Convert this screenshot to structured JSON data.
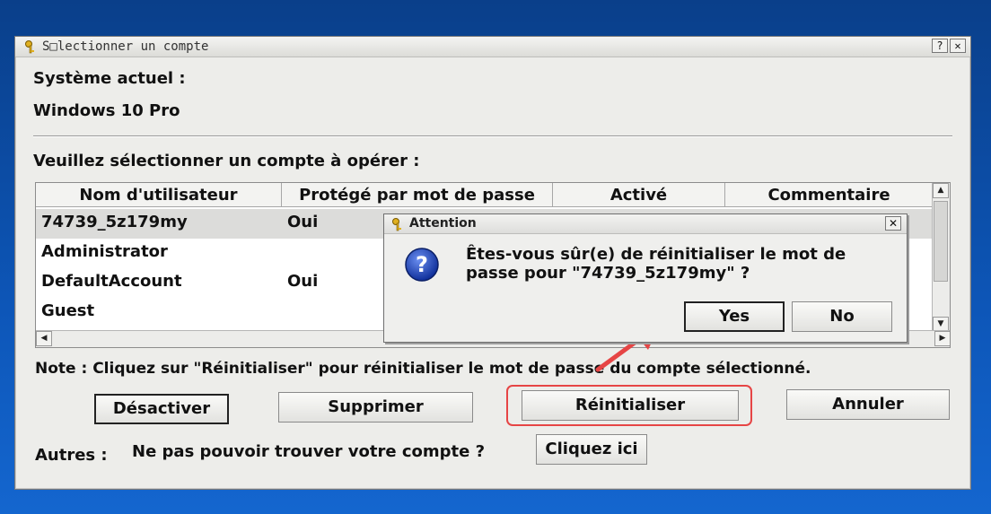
{
  "window": {
    "title": "S□lectionner un compte",
    "help_btn": "?",
    "close_btn": "✕"
  },
  "system": {
    "label": "Système actuel :",
    "value": "Windows 10 Pro"
  },
  "table": {
    "prompt": "Veuillez sélectionner un compte à opérer :",
    "headers": [
      "Nom d'utilisateur",
      "Protégé par mot de passe",
      "Activé",
      "Commentaire"
    ],
    "rows": [
      {
        "user": "74739_5z179my",
        "protected": "Oui"
      },
      {
        "user": "Administrator",
        "protected": ""
      },
      {
        "user": "DefaultAccount",
        "protected": "Oui"
      },
      {
        "user": "Guest",
        "protected": ""
      }
    ]
  },
  "note": "Note : Cliquez sur \"Réinitialiser\" pour réinitialiser le mot de passe du compte sélectionné.",
  "buttons": {
    "deactivate": "Désactiver",
    "delete": "Supprimer",
    "reset": "Réinitialiser",
    "cancel": "Annuler"
  },
  "others": {
    "label": "Autres :",
    "text": "Ne pas pouvoir trouver votre compte ?",
    "link": "Cliquez ici"
  },
  "dialog": {
    "title": "Attention",
    "close_btn": "✕",
    "message_line1": "Êtes-vous sûr(e) de réinitialiser le mot de",
    "message_line2": "passe pour \"74739_5z179my\" ?",
    "yes": "Yes",
    "no": "No"
  },
  "colors": {
    "annotation": "#e64545",
    "desktop": "#0d56b8"
  }
}
